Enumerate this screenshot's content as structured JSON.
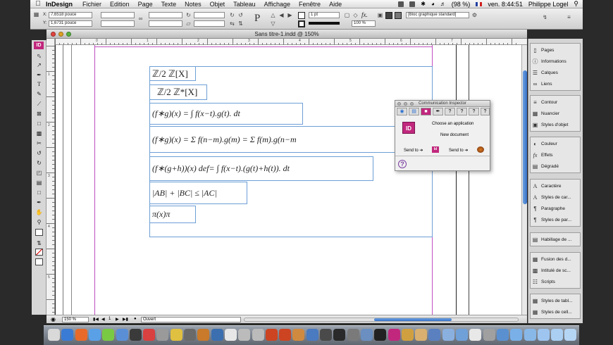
{
  "menubar": {
    "app_name": "InDesign",
    "items": [
      "Fichier",
      "Edition",
      "Page",
      "Texte",
      "Notes",
      "Objet",
      "Tableau",
      "Affichage",
      "Fenêtre",
      "Aide"
    ],
    "battery": "(98 %)",
    "clock": "ven. 8:44:51",
    "user": "Philippe Logel"
  },
  "control_panel": {
    "x_label": "X:",
    "x_value": "7,6518 pouce",
    "y_label": "Y:",
    "y_value": "1,6731 pouce",
    "stroke_weight": "1 pt",
    "zoom_percent": "100 %",
    "frame_style": "[Bloc graphique standard]"
  },
  "window": {
    "title": "Sans titre-1.indd @ 150%"
  },
  "rulers": {
    "top_labels": [
      "0",
      "1",
      "2",
      "3",
      "4",
      "5",
      "6",
      "7"
    ],
    "left_labels": [
      "1",
      "2",
      "3",
      "4",
      "5"
    ]
  },
  "formulas": [
    "ℤ/2 ℤ[X]",
    "ℤ/2 ℤ*[X]",
    "(f∗g)(x) = ∫ f(x−t).g(t). dt",
    "(f∗g)(x) = Σ f(n−m).g(m) = Σ f(m).g(n−m",
    "(f∗(g+h))(x) def= ∫ f(x−t).(g(t)+h(t)). dt",
    "|AB| + |BC| ≤ |AC|",
    "π(x)π"
  ],
  "statusbar": {
    "zoom": "150 %",
    "page": "1",
    "state": "Ouvert"
  },
  "panels": {
    "group1": [
      "Pages",
      "Informations",
      "Calques",
      "Liens"
    ],
    "group2": [
      "Contour",
      "Nuancier",
      "Styles d'objet"
    ],
    "group3": [
      "Couleur",
      "Effets",
      "Dégradé"
    ],
    "group4": [
      "Caractère",
      "Styles de car...",
      "Paragraphe",
      "Styles de par..."
    ],
    "group5": [
      "Habillage de ..."
    ],
    "group6": [
      "Fusion des d...",
      "Intitulé de sc...",
      "Scripts"
    ],
    "group7": [
      "Styles de tabl...",
      "Styles de cell..."
    ]
  },
  "inspector": {
    "title": "Communication Inspector",
    "choose_app": "Choose an application",
    "new_document": "New document",
    "send_to_1": "Send to ➔",
    "send_to_2": "Send to ➔",
    "help": "?"
  },
  "app_logo": "ID",
  "colors": {
    "frame_border": "#6d9fd6",
    "margin_guide": "#c04fc0",
    "indesign_pink": "#c1287d"
  }
}
